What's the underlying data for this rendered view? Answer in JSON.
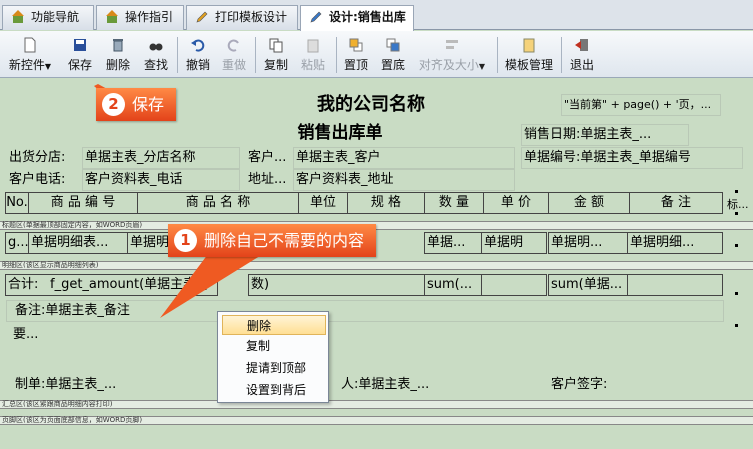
{
  "tabs": [
    {
      "label": "功能导航",
      "active": false
    },
    {
      "label": "操作指引",
      "active": false
    },
    {
      "label": "打印模板设计",
      "active": false
    },
    {
      "label": "设计:销售出库",
      "active": true
    }
  ],
  "toolbar": {
    "new": "新控件",
    "save": "保存",
    "delete": "删除",
    "find": "查找",
    "undo": "撤销",
    "redo": "重做",
    "copy": "复制",
    "paste": "粘贴",
    "top": "置顶",
    "bottom": "置底",
    "align": "对齐及大小",
    "template": "模板管理",
    "exit": "退出"
  },
  "report": {
    "page_no": "\"当前第\" + page() + '页，...",
    "company": "我的公司名称",
    "title": "销售出库单",
    "sale_date": "销售日期:单据主表_...",
    "branch_label": "出货分店:",
    "branch_value": "单据主表_分店名称",
    "customer_label": "客户...",
    "customer_value": "单据主表_客户",
    "bill_no": "单据编号:单据主表_单据编号",
    "phone_label": "客户电话:",
    "phone_value": "客户资料表_电话",
    "addr_label": "地址...",
    "addr_value": "客户资料表_地址",
    "columns": [
      "No.",
      "商 品 编 号",
      "商 品 名 称",
      "单位",
      "规 格",
      "数 量",
      "单 价",
      "金 额",
      "备 注"
    ],
    "tail_label": "标...",
    "band_title": "标题区(单据最顶部固定内容，如WORD页眉)",
    "detail_cells": [
      "g...",
      "单据明细表...",
      "单据明",
      "单据...",
      "单据明",
      "单据明...",
      "单据明细..."
    ],
    "band_detail": "明细区(该区显示商品明细列表)",
    "sum_label": "合计:",
    "sum_amount": "f_get_amount(单据主表_(",
    "sum_obj": "数)",
    "sum_qty": "sum(...",
    "sum_money": "sum(单据...",
    "remark": "备注:单据主表_备注",
    "want": "要...",
    "maker": "制单:单据主表_...",
    "handler": "人:单据主表_...",
    "signature": "客户签字:",
    "band_summary": "汇总区(该区紧跟商品明细内容打印)",
    "band_footer": "页脚区(该区为页面底部信息，如WORD页脚)"
  },
  "callouts": {
    "save": {
      "num": "2",
      "text": "保存"
    },
    "delete": {
      "num": "1",
      "text": "删除自己不需要的内容"
    }
  },
  "context_menu": [
    "删除",
    "复制",
    "提请到顶部",
    "设置到背后"
  ],
  "colors": {
    "callout": "#ef5a22",
    "canvas": "#c9dcc4",
    "highlight": "#ffdf94"
  }
}
